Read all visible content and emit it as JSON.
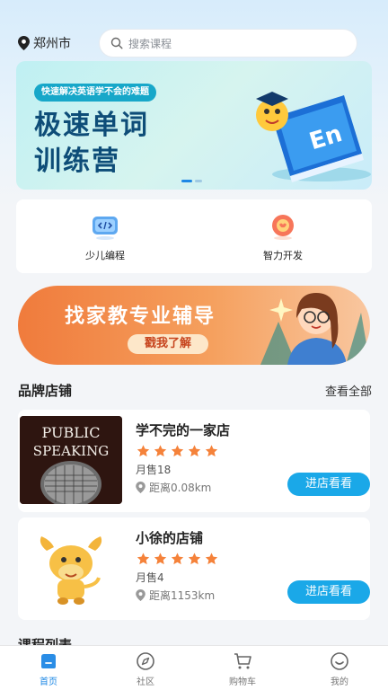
{
  "header": {
    "city": "郑州市",
    "search_placeholder": "搜索课程"
  },
  "banner": {
    "tag": "快速解决英语学不会的难题",
    "title_line1": "极速单词",
    "title_line2": "训练营",
    "book_label": "En"
  },
  "categories": [
    {
      "label": "少儿编程",
      "icon": "coding-icon"
    },
    {
      "label": "智力开发",
      "icon": "brain-icon"
    }
  ],
  "promo": {
    "title": "找家教专业辅导",
    "cta": "戳我了解"
  },
  "stores_section": {
    "title": "品牌店铺",
    "more": "查看全部"
  },
  "stores": [
    {
      "name": "学不完的一家店",
      "rating": 5,
      "sales": "月售18",
      "distance": "距离0.08km",
      "enter_label": "进店看看",
      "thumb_text_line1": "PUBLIC",
      "thumb_text_line2": "SPEAKING"
    },
    {
      "name": "小徐的店铺",
      "rating": 5,
      "sales": "月售4",
      "distance": "距离1153km",
      "enter_label": "进店看看"
    }
  ],
  "course_section": {
    "title": "课程列表"
  },
  "tabs": [
    {
      "label": "首页",
      "icon": "home-icon",
      "active": true
    },
    {
      "label": "社区",
      "icon": "compass-icon",
      "active": false
    },
    {
      "label": "购物车",
      "icon": "cart-icon",
      "active": false
    },
    {
      "label": "我的",
      "icon": "profile-icon",
      "active": false
    }
  ],
  "colors": {
    "accent": "#1aa8e8",
    "star": "#f5823a",
    "active_tab": "#1e88e5"
  }
}
